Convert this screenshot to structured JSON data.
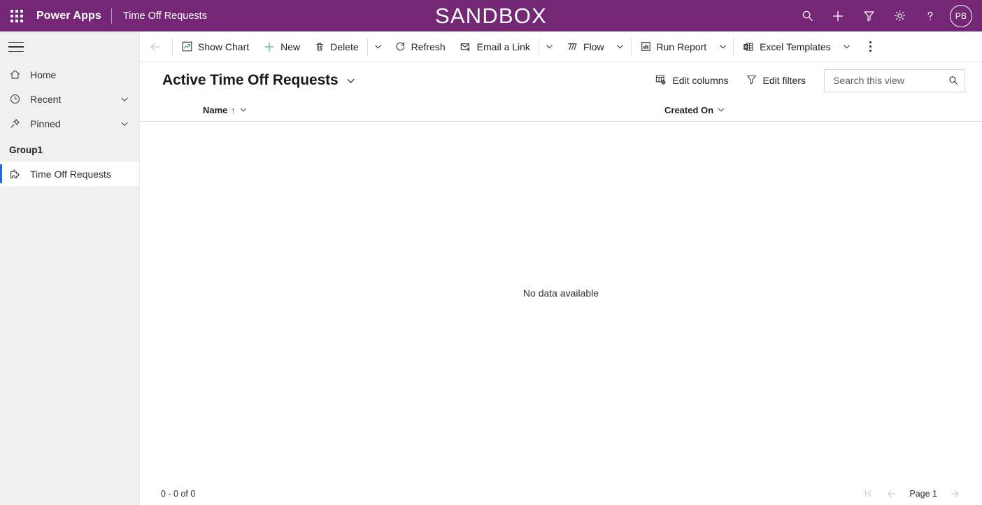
{
  "header": {
    "waffle_icon": "app-launcher-icon",
    "brand": "Power Apps",
    "app_name": "Time Off Requests",
    "environment_banner": "SANDBOX",
    "icons": [
      {
        "name": "search-icon",
        "label": "Search"
      },
      {
        "name": "plus-icon",
        "label": "New"
      },
      {
        "name": "filter-icon",
        "label": "Filter"
      },
      {
        "name": "gear-icon",
        "label": "Settings"
      },
      {
        "name": "help-icon",
        "label": "Help"
      }
    ],
    "avatar_initials": "PB",
    "background_color": "#742774"
  },
  "sidebar": {
    "hamburger_label": "Expand/Collapse navigation",
    "items": [
      {
        "label": "Home",
        "icon": "home-icon",
        "chevron": false,
        "selected": false
      },
      {
        "label": "Recent",
        "icon": "clock-icon",
        "chevron": true,
        "selected": false
      },
      {
        "label": "Pinned",
        "icon": "pin-icon",
        "chevron": true,
        "selected": false
      }
    ],
    "group_label": "Group1",
    "group_items": [
      {
        "label": "Time Off Requests",
        "icon": "entity-icon",
        "selected": true
      }
    ],
    "selected_accent_color": "#2266e3",
    "background_color": "#f0f0f0"
  },
  "command_bar": {
    "back_label": "Back",
    "commands": [
      {
        "label": "Show Chart",
        "icon": "show-chart-icon",
        "caret": false
      },
      {
        "label": "New",
        "icon": "plus-icon",
        "caret": false
      },
      {
        "label": "Delete",
        "icon": "trash-icon",
        "caret": true
      },
      {
        "label": "Refresh",
        "icon": "refresh-icon",
        "caret": false
      },
      {
        "label": "Email a Link",
        "icon": "email-link-icon",
        "caret": true
      },
      {
        "label": "Flow",
        "icon": "flow-icon",
        "caret": true
      },
      {
        "label": "Run Report",
        "icon": "report-icon",
        "caret": true
      },
      {
        "label": "Excel Templates",
        "icon": "excel-icon",
        "caret": true
      }
    ],
    "overflow_label": "More commands"
  },
  "view": {
    "title": "Active Time Off Requests",
    "title_chevron": "chevron-down-icon",
    "edit_columns_label": "Edit columns",
    "edit_filters_label": "Edit filters",
    "search_placeholder": "Search this view",
    "search_value": ""
  },
  "grid": {
    "columns": [
      {
        "label": "Name",
        "sorted": true,
        "sort_direction": "↑"
      },
      {
        "label": "Created On",
        "sorted": false,
        "sort_direction": ""
      }
    ],
    "rows": [],
    "empty_message": "No data available"
  },
  "footer": {
    "record_count": "0 - 0 of 0",
    "page_label": "Page 1",
    "first_page_icon": "first-page-icon",
    "prev_page_icon": "previous-page-icon",
    "next_page_icon": "next-page-icon"
  }
}
